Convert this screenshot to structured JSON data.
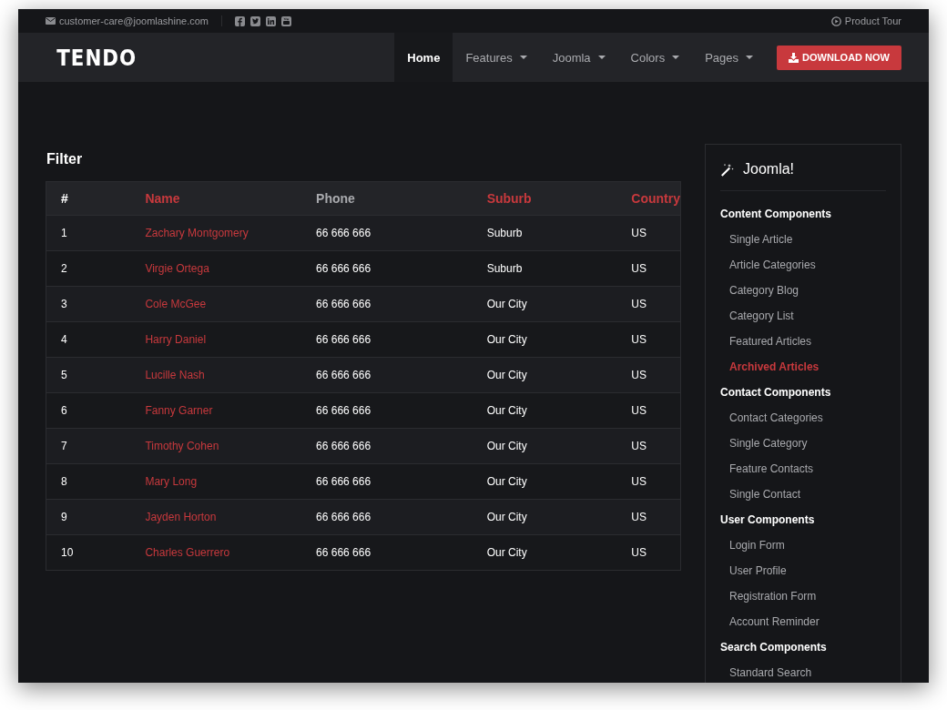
{
  "topbar": {
    "email": "customer-care@joomlashine.com",
    "product_tour": "Product Tour"
  },
  "nav": {
    "logo": "TENDO",
    "items": [
      {
        "label": "Home",
        "selected": true,
        "dropdown": false
      },
      {
        "label": "Features",
        "selected": false,
        "dropdown": true
      },
      {
        "label": "Joomla",
        "selected": false,
        "dropdown": true
      },
      {
        "label": "Colors",
        "selected": false,
        "dropdown": true
      },
      {
        "label": "Pages",
        "selected": false,
        "dropdown": true
      }
    ],
    "download_button": "DOWNLOAD NOW"
  },
  "filter_title": "Filter",
  "table": {
    "columns": [
      {
        "label": "#",
        "kind": "index"
      },
      {
        "label": "Name",
        "kind": "link"
      },
      {
        "label": "Phone",
        "kind": "plain"
      },
      {
        "label": "Suburb",
        "kind": "sortable"
      },
      {
        "label": "Country",
        "kind": "sortable"
      }
    ],
    "rows": [
      [
        "1",
        "Zachary Montgomery",
        "66 666 666",
        "Suburb",
        "US"
      ],
      [
        "2",
        "Virgie Ortega",
        "66 666 666",
        "Suburb",
        "US"
      ],
      [
        "3",
        "Cole McGee",
        "66 666 666",
        "Our City",
        "US"
      ],
      [
        "4",
        "Harry Daniel",
        "66 666 666",
        "Our City",
        "US"
      ],
      [
        "5",
        "Lucille Nash",
        "66 666 666",
        "Our City",
        "US"
      ],
      [
        "6",
        "Fanny Garner",
        "66 666 666",
        "Our City",
        "US"
      ],
      [
        "7",
        "Timothy Cohen",
        "66 666 666",
        "Our City",
        "US"
      ],
      [
        "8",
        "Mary Long",
        "66 666 666",
        "Our City",
        "US"
      ],
      [
        "9",
        "Jayden Horton",
        "66 666 666",
        "Our City",
        "US"
      ],
      [
        "10",
        "Charles Guerrero",
        "66 666 666",
        "Our City",
        "US"
      ]
    ]
  },
  "sidebar": {
    "title": "Joomla!",
    "sections": [
      {
        "heading": "Content Components",
        "items": [
          {
            "label": "Single Article",
            "selected": false
          },
          {
            "label": "Article Categories",
            "selected": false
          },
          {
            "label": "Category Blog",
            "selected": false
          },
          {
            "label": "Category List",
            "selected": false
          },
          {
            "label": "Featured Articles",
            "selected": false
          },
          {
            "label": "Archived Articles",
            "selected": true
          }
        ]
      },
      {
        "heading": "Contact Components",
        "items": [
          {
            "label": "Contact Categories",
            "selected": false
          },
          {
            "label": "Single Category",
            "selected": false
          },
          {
            "label": "Feature Contacts",
            "selected": false
          },
          {
            "label": "Single Contact",
            "selected": false
          }
        ]
      },
      {
        "heading": "User Components",
        "items": [
          {
            "label": "Login Form",
            "selected": false
          },
          {
            "label": "User Profile",
            "selected": false
          },
          {
            "label": "Registration Form",
            "selected": false
          },
          {
            "label": "Account Reminder",
            "selected": false
          }
        ]
      },
      {
        "heading": "Search Components",
        "items": [
          {
            "label": "Standard Search",
            "selected": false
          }
        ]
      }
    ]
  }
}
